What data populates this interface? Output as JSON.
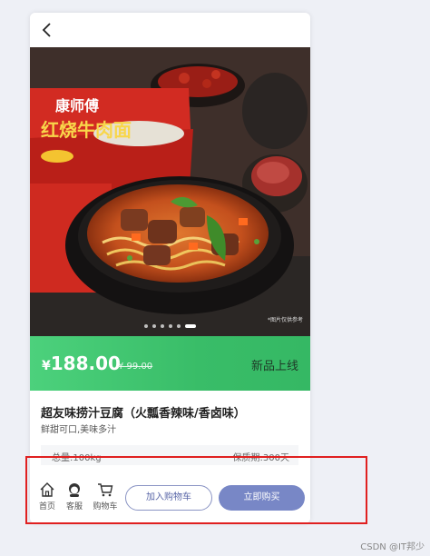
{
  "product": {
    "price_currency": "¥",
    "price_value": "188.00",
    "old_price": "¥ 99.00",
    "status_tag": "新品上线",
    "title": "超友味捞汁豆腐（火瓢香辣味/香卤味）",
    "subtitle": "鲜甜可口,美味多汁",
    "weight": "总量:100kg",
    "shelf_life": "保质期:300天"
  },
  "hero": {
    "brand_text": "康师傅",
    "product_name": "红烧牛肉面",
    "disclaimer": "*图片仅供参考",
    "slides": 6,
    "active_slide": 6
  },
  "bottom_nav": {
    "home_label": "首页",
    "service_label": "客服",
    "cart_label": "购物车",
    "add_to_cart": "加入购物车",
    "buy_now": "立即购买"
  },
  "watermark": "CSDN @IT邦少",
  "colors": {
    "price_bar": "#3cc06b",
    "buy_button": "#7887c6",
    "cart_button_border": "#8a94c4",
    "highlight": "#e02020",
    "page_bg": "#eef0f6"
  }
}
